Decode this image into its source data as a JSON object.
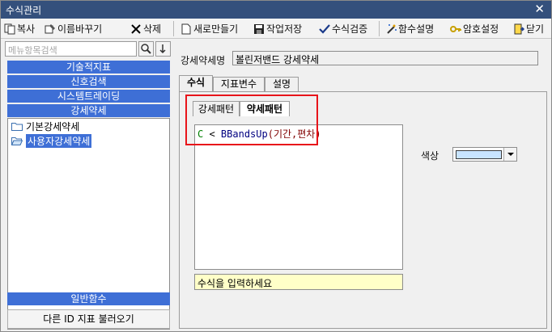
{
  "window": {
    "title": "수식관리",
    "close": "✕"
  },
  "toolbar": {
    "copy": "복사",
    "rename": "이름바꾸기",
    "delete": "삭제",
    "new": "새로만들기",
    "save": "작업저장",
    "verify": "수식검증",
    "func_help": "함수설명",
    "password": "암호설정",
    "close": "닫기"
  },
  "sidebar": {
    "search_placeholder": "메뉴항목검색",
    "categories": [
      "기술적지표",
      "신호검색",
      "시스템트레이딩",
      "강세약세"
    ],
    "tree": [
      "기본강세약세",
      "사용자강세약세"
    ],
    "footer_category": "일반함수",
    "load_button": "다른 ID 지표 불러오기"
  },
  "main": {
    "name_label": "강세약세명",
    "name_value": "볼린저밴드 강세약세",
    "tabs": [
      "수식",
      "지표변수",
      "설명"
    ],
    "subtabs": [
      "강세패턴",
      "약세패턴"
    ],
    "formula": {
      "c": "C",
      "op": " < ",
      "fn": "BBandsUp",
      "args": "(기간,편차)"
    },
    "hint": "수식을 입력하세요",
    "color_label": "색상",
    "color_value": "#c8e4ff"
  }
}
